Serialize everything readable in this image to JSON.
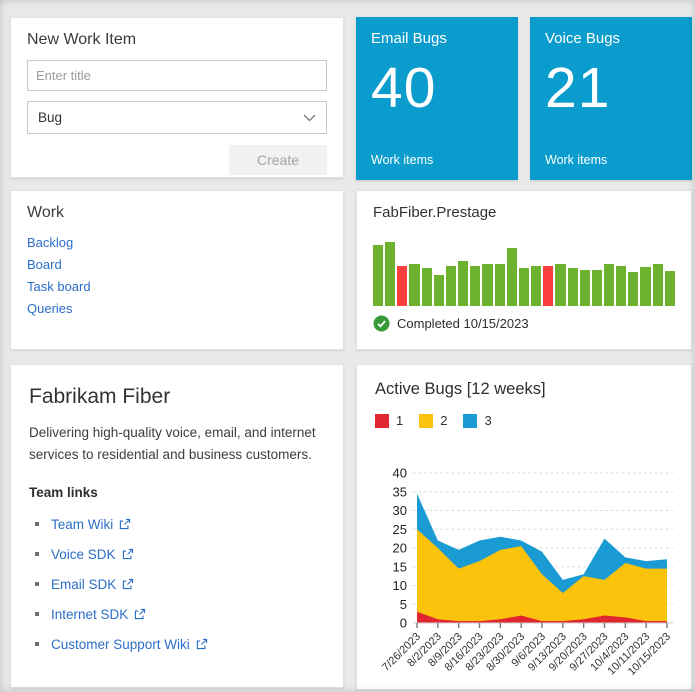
{
  "new_work_item": {
    "title": "New Work Item",
    "title_input": {
      "value": "",
      "placeholder": "Enter title"
    },
    "type_select": {
      "selected": "Bug"
    },
    "create_button": "Create"
  },
  "tile_color": "#0a9ccd",
  "query_tiles": [
    {
      "title": "Email Bugs",
      "count": "40",
      "subtitle": "Work items"
    },
    {
      "title": "Voice Bugs",
      "count": "21",
      "subtitle": "Work items"
    }
  ],
  "work": {
    "title": "Work",
    "links": [
      "Backlog",
      "Board",
      "Task board",
      "Queries"
    ]
  },
  "build": {
    "title": "FabFiber.Prestage",
    "status_label": "Completed 10/15/2023",
    "status_icon": "check-circle",
    "success_color": "#6cb22f",
    "failed_color": "#fb3e3e",
    "heights_pct": [
      96,
      100,
      63,
      65,
      59,
      48,
      63,
      71,
      62,
      66,
      66,
      90,
      60,
      63,
      63,
      66,
      60,
      57,
      57,
      65,
      63,
      53,
      61,
      66,
      55
    ],
    "failed_indexes": [
      2,
      14
    ]
  },
  "team": {
    "title": "Fabrikam Fiber",
    "description": "Delivering high-quality voice, email, and internet services to residential and business customers.",
    "links_heading": "Team links",
    "links": [
      "Team Wiki",
      "Voice SDK",
      "Email SDK",
      "Internet SDK",
      "Customer Support Wiki"
    ]
  },
  "chart_data": {
    "type": "area",
    "stacked": true,
    "title": "Active Bugs [12 weeks]",
    "x": [
      "7/26/2023",
      "8/2/2023",
      "8/9/2023",
      "8/16/2023",
      "8/23/2023",
      "8/30/2023",
      "9/6/2023",
      "9/13/2023",
      "9/20/2023",
      "9/27/2023",
      "10/4/2023",
      "10/11/2023",
      "10/15/2023"
    ],
    "series": [
      {
        "name": "1",
        "color": "#e0262e",
        "values": [
          3,
          1,
          0.5,
          0.5,
          1,
          2,
          0.5,
          0.5,
          1,
          2,
          1.5,
          0.5,
          0.5
        ]
      },
      {
        "name": "2",
        "color": "#fbc30c",
        "values": [
          22,
          19,
          14,
          16,
          18.5,
          18.5,
          12.5,
          7.5,
          11.5,
          9.5,
          14.5,
          14,
          14
        ]
      },
      {
        "name": "3",
        "color": "#1b9bd4",
        "values": [
          9.5,
          2,
          5,
          5.5,
          3.5,
          1.5,
          6,
          3.5,
          0.5,
          11,
          1.5,
          2,
          2.5
        ]
      }
    ],
    "ylim": [
      0,
      40
    ],
    "ytick_step": 5,
    "grid": "dashed",
    "legend_position": "top-left",
    "xlabel": "",
    "ylabel": ""
  }
}
